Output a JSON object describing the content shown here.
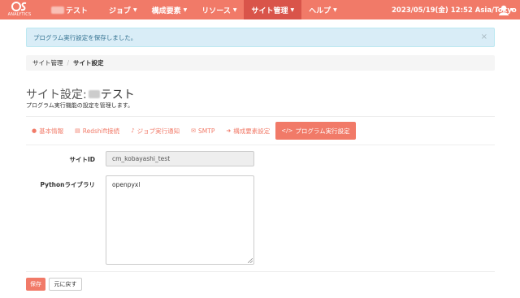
{
  "app": {
    "logo_text": "ANALYTICS",
    "site_name_suffix": "テスト"
  },
  "nav": {
    "items": [
      {
        "label": "ジョブ"
      },
      {
        "label": "構成要素"
      },
      {
        "label": "リソース"
      },
      {
        "label": "サイト管理"
      },
      {
        "label": "ヘルプ"
      }
    ],
    "active_item": "サイト管理",
    "datetime": "2023/05/19(金) 12:52 Asia/Tokyo"
  },
  "alert": {
    "message": "プログラム実行設定を保存しました。",
    "close": "×"
  },
  "breadcrumb": {
    "items": [
      "サイト管理",
      "サイト設定"
    ],
    "separator": "/"
  },
  "page": {
    "title_prefix": "サイト設定:",
    "title_suffix": "テスト",
    "subtitle": "プログラム実行機能の設定を管理します。"
  },
  "tabs": [
    {
      "label": "基本情報",
      "icon": "info-circle-icon",
      "glyph": "❶"
    },
    {
      "label": "Redshift接続",
      "icon": "database-icon",
      "glyph": "▦"
    },
    {
      "label": "ジョブ実行通知",
      "icon": "bell-icon",
      "glyph": "🔔"
    },
    {
      "label": "SMTP",
      "icon": "envelope-icon",
      "glyph": "✉"
    },
    {
      "label": "構成要素設定",
      "icon": "sign-in-icon",
      "glyph": "➜"
    },
    {
      "label": "プログラム実行設定",
      "icon": "code-icon",
      "glyph": "</>"
    }
  ],
  "active_tab": "プログラム実行設定",
  "form": {
    "site_id_label": "サイトID",
    "site_id_value": "cm_kobayashi_test",
    "python_label": "Pythonライブラリ",
    "python_value": "openpyxl"
  },
  "buttons": {
    "save": "保存",
    "reset": "元に戻す"
  },
  "colors": {
    "brand": "#f17a68",
    "brand_active": "#d9544a",
    "alert_bg": "#d9edf7",
    "alert_text": "#31708f"
  }
}
